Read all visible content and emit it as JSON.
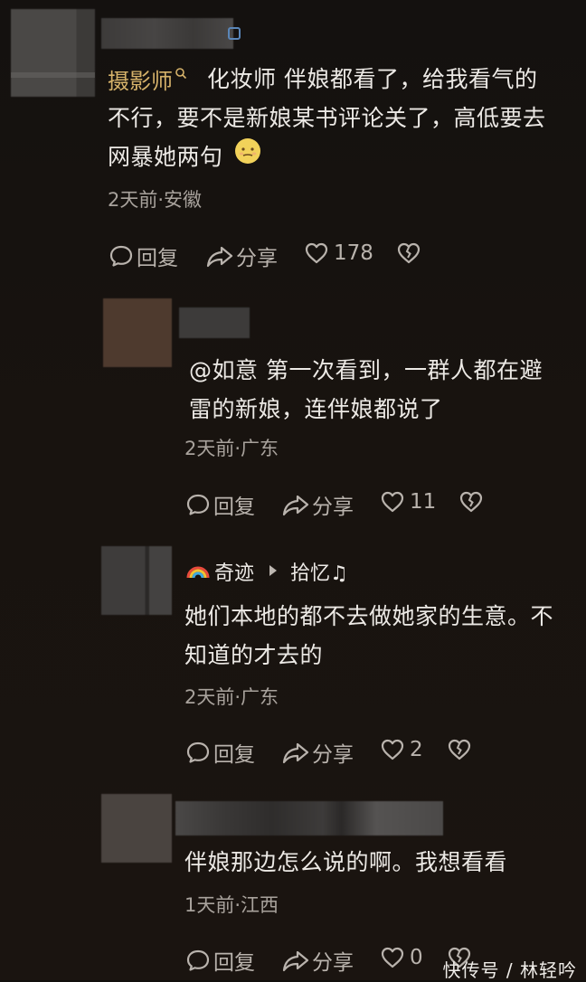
{
  "comments": [
    {
      "username": "摄影师",
      "text_lines": [
        "化妆师  伴娘都看了，给我看气的",
        "不行，要不是新娘某书评论关了，高低要去",
        "网暴她两句"
      ],
      "meta": "2天前·安徽",
      "reply_label": "回复",
      "share_label": "分享",
      "likes": "178"
    },
    {
      "text_lines": [
        "@如意  第一次看到，一群人都在避",
        "雷的新娘，连伴娘都说了"
      ],
      "meta": "2天前·广东",
      "reply_label": "回复",
      "share_label": "分享",
      "likes": "11"
    },
    {
      "username": "奇迹",
      "reply_to": "拾忆♫",
      "text_lines": [
        "她们本地的都不去做她家的生意。不",
        "知道的才去的"
      ],
      "meta": "2天前·广东",
      "reply_label": "回复",
      "share_label": "分享",
      "likes": "2"
    },
    {
      "text_lines": [
        "伴娘那边怎么说的啊。我想看看"
      ],
      "meta": "1天前·江西",
      "reply_label": "回复",
      "share_label": "分享",
      "likes": "0"
    }
  ],
  "watermark": "快传号 / 林轻吟",
  "icons": [
    "comment-icon",
    "share-icon",
    "heart-icon",
    "broken-heart-icon",
    "search-icon",
    "rainbow-icon",
    "play-arrow-icon"
  ],
  "colors": {
    "background": "#14110f",
    "username_gold": "#d6b26a",
    "text": "#ece9e5",
    "meta": "#a8a29c"
  }
}
